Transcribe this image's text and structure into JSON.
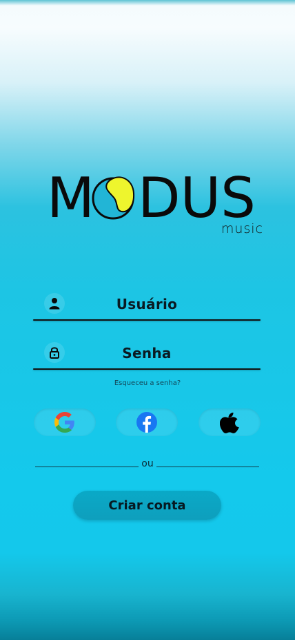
{
  "brand": {
    "wordmark_start": "M",
    "wordmark_end": "DUS",
    "subtitle": "music",
    "logo_blob_color": "#eef52d",
    "logo_circle_color": "#22b5d6"
  },
  "login": {
    "username_label": "Usuário",
    "username_icon": "user-icon",
    "password_label": "Senha",
    "password_icon": "lock-icon",
    "forgot_password": "Esqueceu a senha?"
  },
  "social": [
    {
      "name": "google",
      "icon": "google-icon"
    },
    {
      "name": "facebook",
      "icon": "facebook-icon",
      "color": "#1877f2"
    },
    {
      "name": "apple",
      "icon": "apple-icon"
    }
  ],
  "divider_text": "ou",
  "create_account_label": "Criar conta"
}
